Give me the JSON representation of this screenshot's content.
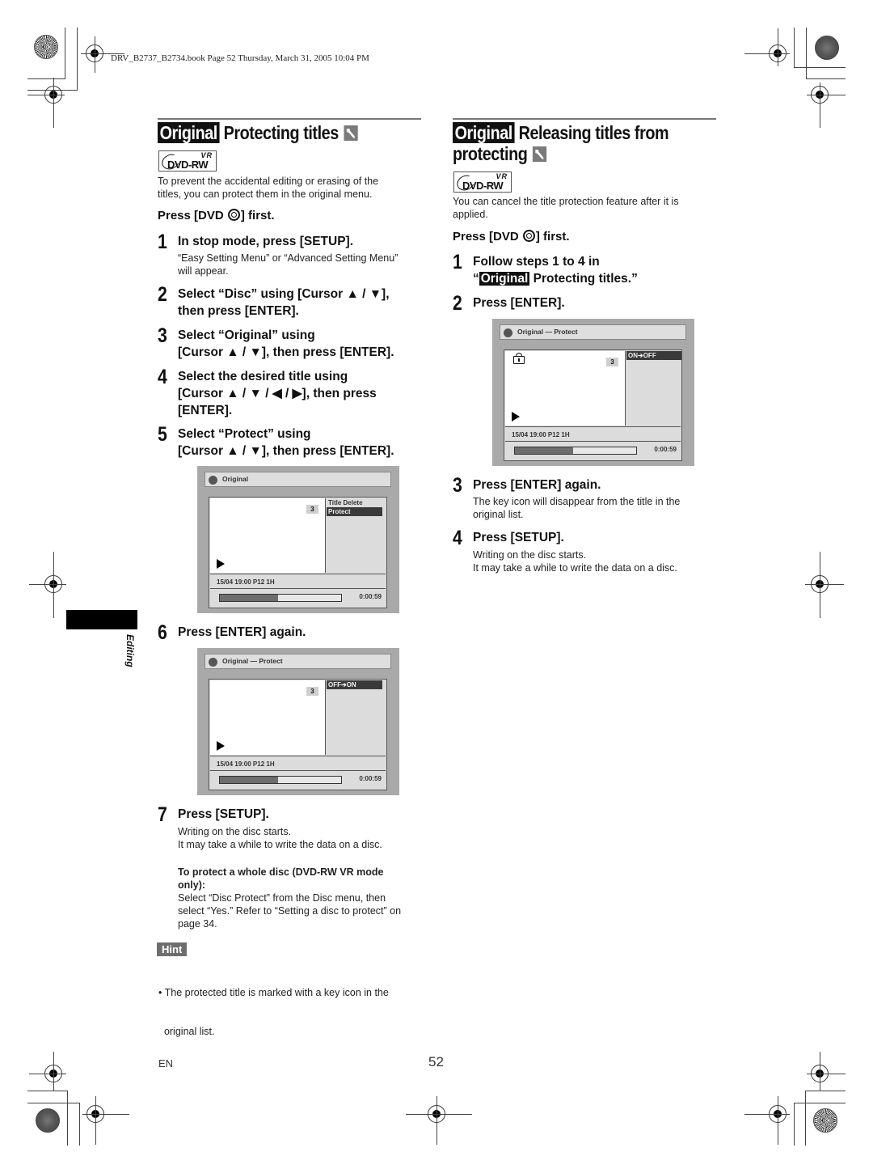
{
  "print_header": "DRV_B2737_B2734.book  Page 52  Thursday, March 31, 2005  10:04 PM",
  "badge_original": "Original",
  "logo": {
    "vr": "VR",
    "text": "DVD-RW"
  },
  "left": {
    "title": "Protecting titles",
    "intro": [
      "To prevent the accidental editing or erasing of the",
      "titles, you can protect them in the original menu."
    ],
    "press_first": {
      "pre": "Press [DVD ",
      "post": "] first."
    },
    "steps": [
      {
        "num": "1",
        "lines": [
          "In stop mode, press [SETUP]."
        ],
        "sub": [
          "“Easy Setting Menu” or “Advanced Setting Menu”",
          "will appear."
        ]
      },
      {
        "num": "2",
        "lines": [
          "Select “Disc” using [Cursor ▲ / ▼],",
          "then press [ENTER]."
        ]
      },
      {
        "num": "3",
        "lines": [
          "Select “Original” using",
          "[Cursor ▲ / ▼], then press [ENTER]."
        ]
      },
      {
        "num": "4",
        "lines": [
          "Select the desired title using",
          "[Cursor ▲ / ▼ / ◀ / ▶], then press",
          "[ENTER]."
        ]
      },
      {
        "num": "5",
        "lines": [
          "Select “Protect” using",
          "[Cursor ▲ / ▼], then press [ENTER]."
        ]
      },
      {
        "num": "6",
        "lines": [
          "Press [ENTER] again."
        ]
      },
      {
        "num": "7",
        "lines": [
          "Press [SETUP]."
        ],
        "sub": [
          "Writing on the disc starts.",
          "It may take a while to write the data on a disc."
        ]
      }
    ],
    "screen1": {
      "title": "Original",
      "number": "3",
      "menu": [
        {
          "label": "Title Delete",
          "selected": false
        },
        {
          "label": "Protect",
          "selected": true
        }
      ],
      "info": "15/04  19:00  P12  1H",
      "progress": 0.48,
      "time": "0:00:59"
    },
    "screen2": {
      "title": "Original — Protect",
      "number": "3",
      "menu": [
        {
          "label": "OFF➔ON",
          "selected": true
        }
      ],
      "info": "15/04  19:00  P12  1H",
      "progress": 0.48,
      "time": "0:00:59"
    },
    "note_heading": [
      "To protect a whole disc (DVD-RW VR mode",
      "only):"
    ],
    "note_body": [
      "Select “Disc Protect” from the Disc menu, then",
      "select “Yes.” Refer to “Setting a disc to protect” on",
      "page 34."
    ],
    "hint_label": "Hint",
    "hint_lines": [
      "• The protected title is marked with a key icon in the",
      "  original list."
    ]
  },
  "right": {
    "title_line1": "Releasing titles from",
    "title_line2": "protecting",
    "intro": [
      "You can cancel the title protection feature after it is",
      "applied."
    ],
    "press_first": {
      "pre": "Press [DVD ",
      "post": "] first."
    },
    "steps": [
      {
        "num": "1",
        "line1": "Follow steps 1 to 4 in",
        "line2_pre": "“",
        "line2_post": " Protecting titles.”"
      },
      {
        "num": "2",
        "lines": [
          "Press [ENTER]."
        ]
      },
      {
        "num": "3",
        "lines": [
          "Press [ENTER] again."
        ],
        "sub": [
          "The key icon will disappear from the title in the",
          "original list."
        ]
      },
      {
        "num": "4",
        "lines": [
          "Press [SETUP]."
        ],
        "sub": [
          "Writing on the disc starts.",
          "It may take a while to write the data on a disc."
        ]
      }
    ],
    "screen": {
      "title": "Original — Protect",
      "number": "3",
      "locked": true,
      "menu": [
        {
          "label": "ON➔OFF",
          "selected": true
        }
      ],
      "info": "15/04  19:00  P12  1H",
      "progress": 0.48,
      "time": "0:00:59"
    }
  },
  "side_tab_label": "Editing",
  "footer": {
    "lang": "EN",
    "page": "52"
  }
}
